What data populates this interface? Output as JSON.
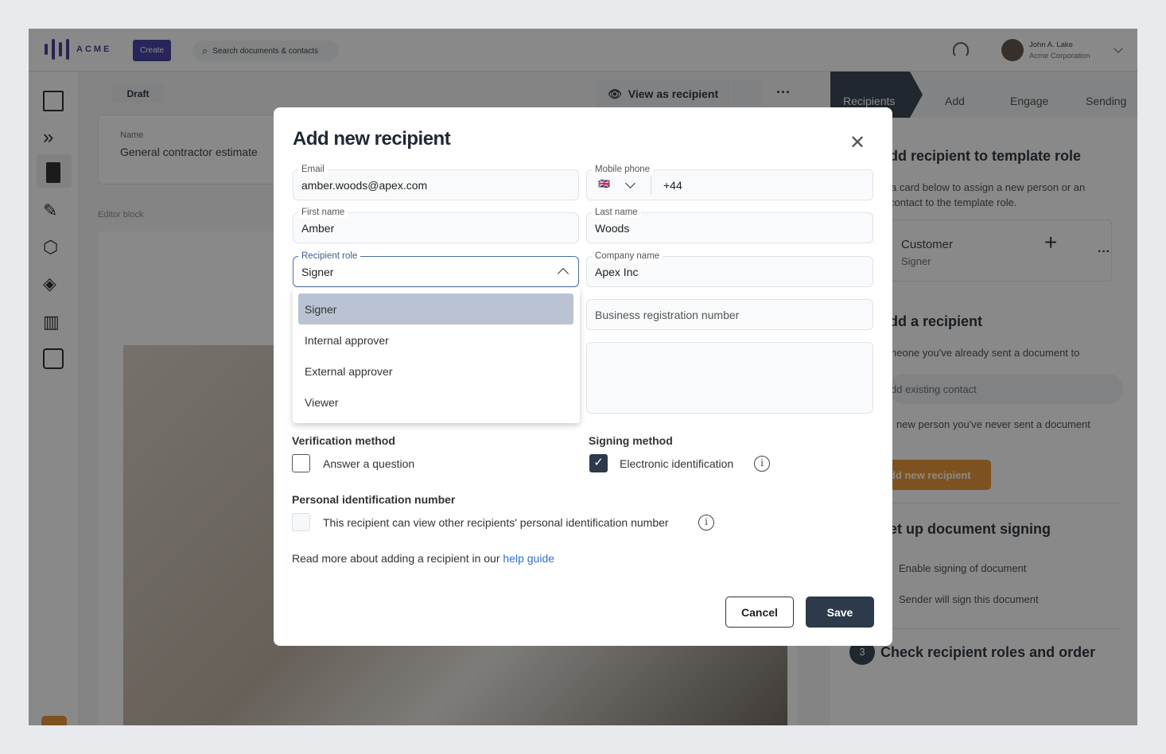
{
  "header": {
    "logo": "ACME",
    "create_label": "Create",
    "search_placeholder": "Search documents & contacts",
    "user_name": "John A. Lake",
    "user_company": "Acme Corporation"
  },
  "sidebar": {
    "items": [
      "layout-icon",
      "steps-icon",
      "document-icon",
      "pen-icon",
      "box-icon",
      "layers-icon",
      "chart-icon",
      "contact-icon"
    ]
  },
  "document": {
    "status": "Draft",
    "name_label": "Name",
    "name_value": "General contractor estimate",
    "editor_label": "Editor block",
    "view_as_recipient": "View as recipient"
  },
  "right_panel": {
    "tabs": [
      "Recipients",
      "Add",
      "Engage",
      "Sending"
    ],
    "section1_title": "dd recipient to template role",
    "section1_text1": "a card below to assign a new person or an",
    "section1_text2": "contact to the template role.",
    "role_card": {
      "name": "Customer",
      "role": "Signer"
    },
    "section2_title": "dd a recipient",
    "section2_text": "neone you've already sent a document to",
    "existing_contact": "dd existing contact",
    "section2_text2": "new person you've never sent a document",
    "add_new_recipient": "dd new recipient",
    "section3_title": "et up document signing",
    "signing_opt1": "Enable signing of document",
    "signing_opt2": "Sender will sign this document",
    "step3_number": "3",
    "step3_title": "Check recipient roles and order"
  },
  "modal": {
    "title": "Add new recipient",
    "email": {
      "label": "Email",
      "value": "amber.woods@apex.com"
    },
    "mobile": {
      "label": "Mobile phone",
      "flag": "🇬🇧",
      "value": "+44"
    },
    "first_name": {
      "label": "First name",
      "value": "Amber"
    },
    "last_name": {
      "label": "Last name",
      "value": "Woods"
    },
    "recipient_role": {
      "label": "Recipient role",
      "value": "Signer",
      "options": [
        "Signer",
        "Internal approver",
        "External approver",
        "Viewer"
      ]
    },
    "company": {
      "label": "Company name",
      "value": "Apex Inc"
    },
    "business_reg": {
      "placeholder": "Business registration number"
    },
    "verification": {
      "title": "Verification method",
      "option": "Answer a question",
      "checked": false
    },
    "signing": {
      "title": "Signing method",
      "option": "Electronic identification",
      "checked": true
    },
    "pin": {
      "title": "Personal identification number",
      "option": "This recipient can view other recipients' personal identification number",
      "checked": false
    },
    "help_text": "Read more about adding a recipient in our",
    "help_link": "help guide",
    "cancel": "Cancel",
    "save": "Save"
  },
  "colors": {
    "brand": "#3d36a0",
    "dark": "#2c3a4b",
    "link": "#2f6fcf",
    "orange": "#e8912c",
    "highlight": "#b9c3d4"
  }
}
